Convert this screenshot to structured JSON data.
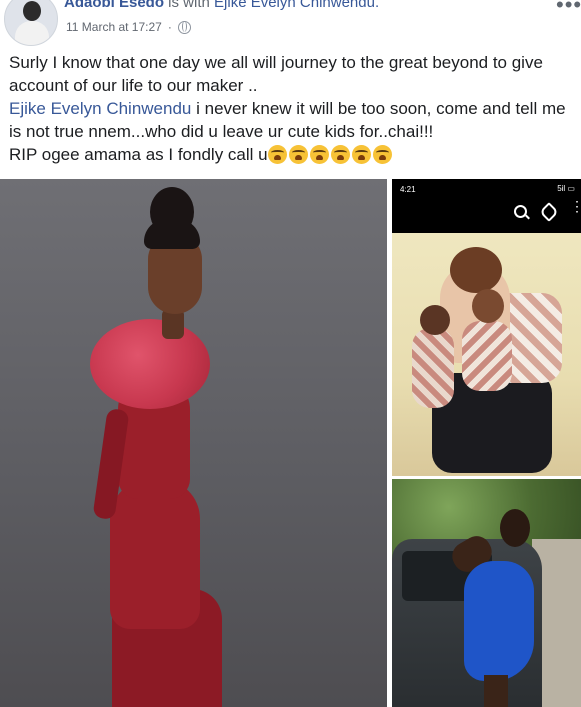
{
  "post": {
    "author_name": "Adaobi Esedo",
    "with_text": " is with ",
    "tagged_name": "Ejike Evelyn Chinwendu.",
    "timestamp": "11 March at 17:27",
    "separator": "·",
    "privacy_icon": "globe-icon",
    "more_icon": "more-options-icon",
    "more_glyph": "•••"
  },
  "body": {
    "line1": "Surly I know that one day we all will journey to the great beyond to give account of our life to our maker ..",
    "mention": "Ejike Evelyn Chinwendu",
    "line2_rest": " i never knew it will be too soon, come and tell me is not true nnem...who did u leave ur cute kids for..chai!!!",
    "line3": "RIP ogee amama as I fondly call u",
    "emoji_name": "loudly-crying-face-emoji",
    "emoji_count": 6
  },
  "photos": {
    "screenshot_status_time": "4:21",
    "screenshot_status_icons": "5il ▭",
    "screenshot_icons": [
      "search-icon",
      "tag-icon",
      "more-vertical-icon"
    ],
    "dots_glyph": "⋮"
  },
  "colors": {
    "link": "#385898",
    "text": "#1c1e21",
    "meta": "#616770"
  }
}
